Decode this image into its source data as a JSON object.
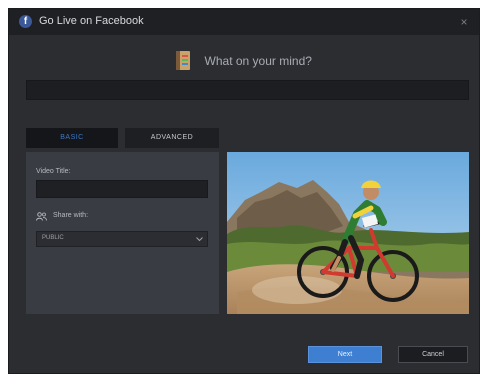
{
  "window": {
    "title": "Go Live on Facebook",
    "logo_letter": "f",
    "close_glyph": "×"
  },
  "status": {
    "prompt": "What on your mind?",
    "value": ""
  },
  "tabs": [
    {
      "label": "BASIC",
      "active": true
    },
    {
      "label": "ADVANCED",
      "active": false
    }
  ],
  "form": {
    "video_title_label": "Video Title:",
    "video_title_value": "",
    "share_with_label": "Share with:",
    "privacy_selected": "PUBLIC"
  },
  "preview": {
    "alt": "Mountain biker riding on a dirt trail"
  },
  "buttons": {
    "next": "Next",
    "cancel": "Cancel"
  },
  "colors": {
    "dialog_bg": "#2b2d31",
    "titlebar_bg": "#1f2024",
    "accent": "#3e7fd1",
    "facebook_blue": "#3b5998"
  }
}
